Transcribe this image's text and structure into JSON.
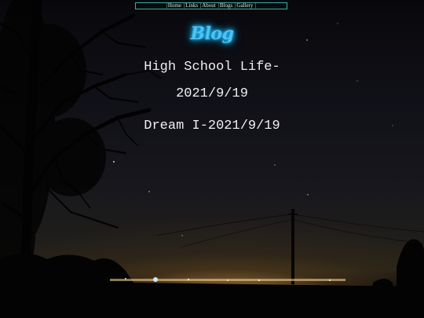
{
  "nav": {
    "items": [
      {
        "label": "Home"
      },
      {
        "label": "Links"
      },
      {
        "label": "About"
      },
      {
        "label": "Blogs"
      },
      {
        "label": "Gallery"
      }
    ],
    "separator": "|"
  },
  "blog": {
    "title": "Blog",
    "entries": [
      {
        "title_line_1": "High School Life-",
        "title_line_2": "2021/9/19"
      },
      {
        "title": "Dream I-2021/9/19"
      }
    ]
  },
  "colors": {
    "title_glow": "#4fc3ee",
    "nav_border": "#2fb3a6",
    "entry_text": "#f0f0f0"
  }
}
